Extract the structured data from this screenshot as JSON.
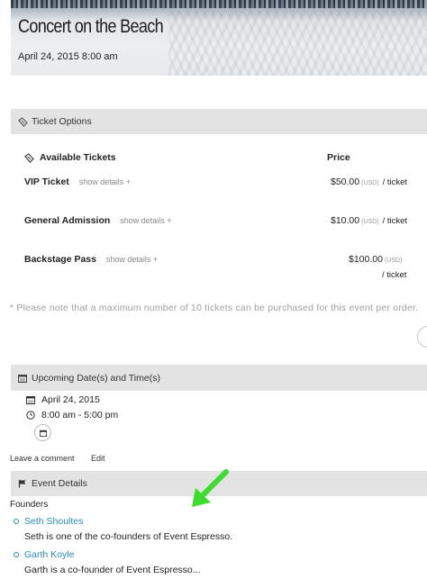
{
  "event": {
    "title": "Concert on the Beach",
    "datetime": "April 24, 2015 8:00 am"
  },
  "ticket_options": {
    "section_title": "Ticket Options",
    "available_header": "Available Tickets",
    "price_header": "Price",
    "tickets": [
      {
        "name": "VIP Ticket",
        "show_details": "show details +",
        "price": "$50.00",
        "currency": "(USD)",
        "per": "/ ticket"
      },
      {
        "name": "General Admission",
        "show_details": "show details +",
        "price": "$10.00",
        "currency": "(USD)",
        "per": "/ ticket"
      },
      {
        "name": "Backstage Pass",
        "show_details": "show details +",
        "price": "$100.00",
        "currency": "(USD)",
        "per": "/ ticket"
      }
    ],
    "note": "* Please note that a maximum number of 10 tickets can be purchased for this event per order."
  },
  "upcoming": {
    "section_title": "Upcoming Date(s) and Time(s)",
    "date": "April 24, 2015",
    "time": "8:00 am - 5:00 pm"
  },
  "post_links": {
    "leave_comment": "Leave a comment",
    "edit": "Edit"
  },
  "event_details": {
    "section_title": "Event Details",
    "founders_label": "Founders",
    "people": [
      {
        "name": "Seth Shoultes",
        "description": "Seth is one of the co-founders of Event Espresso."
      },
      {
        "name": "Garth Koyle",
        "description": "Garth is a co-founder of Event Espresso..."
      }
    ]
  },
  "colors": {
    "link": "#2a8bb5",
    "section_bar": "#e3e3e3",
    "annotation_arrow": "#3ddc2f",
    "note_text": "#a0a0a0"
  }
}
